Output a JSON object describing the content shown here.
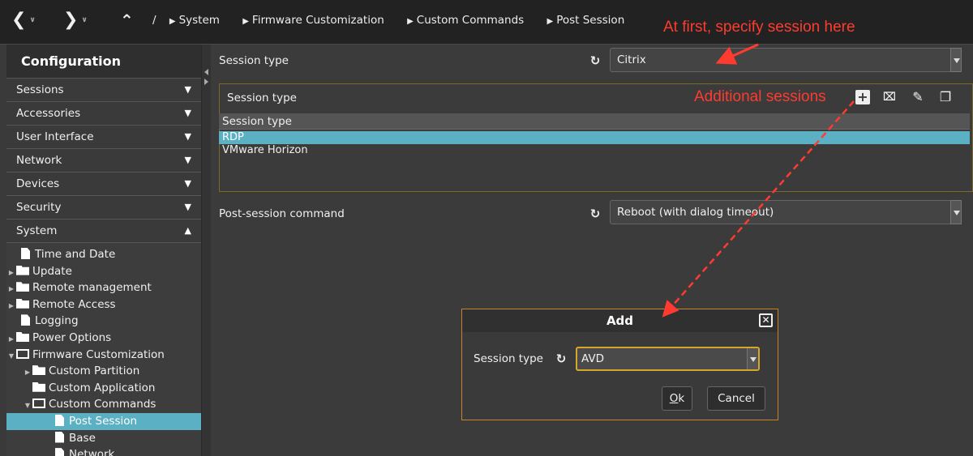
{
  "nav": {
    "back_icon": "chevron-left-icon",
    "forward_icon": "chevron-right-icon",
    "up_icon": "chevron-up-icon"
  },
  "breadcrumb": {
    "root": "/",
    "items": [
      "System",
      "Firmware Customization",
      "Custom Commands",
      "Post Session"
    ]
  },
  "annotations": {
    "top": "At first, specify session here",
    "sessions": "Additional sessions",
    "color": "#ff3b2f"
  },
  "sidebar": {
    "title": "Configuration",
    "sections": [
      {
        "label": "Sessions",
        "state": "collapsed"
      },
      {
        "label": "Accessories",
        "state": "collapsed"
      },
      {
        "label": "User Interface",
        "state": "collapsed"
      },
      {
        "label": "Network",
        "state": "collapsed"
      },
      {
        "label": "Devices",
        "state": "collapsed"
      },
      {
        "label": "Security",
        "state": "collapsed"
      },
      {
        "label": "System",
        "state": "expanded"
      }
    ],
    "tree": [
      {
        "label": "Time and Date"
      },
      {
        "label": "Update"
      },
      {
        "label": "Remote management"
      },
      {
        "label": "Remote Access"
      },
      {
        "label": "Logging"
      },
      {
        "label": "Power Options"
      },
      {
        "label": "Firmware Customization"
      },
      {
        "label": "Custom Partition"
      },
      {
        "label": "Custom Application"
      },
      {
        "label": "Custom Commands"
      },
      {
        "label": "Post Session"
      },
      {
        "label": "Base"
      },
      {
        "label": "Network"
      }
    ]
  },
  "main": {
    "session_type_label": "Session type",
    "session_type_value": "Citrix",
    "group_title": "Session type",
    "table_header": "Session type",
    "rows": [
      "RDP",
      "VMware Horizon"
    ],
    "toolbar_icons": [
      "add-icon",
      "delete-icon",
      "edit-icon",
      "copy-icon"
    ],
    "post_session_label": "Post-session command",
    "post_session_value": "Reboot (with dialog timeout)"
  },
  "dialog": {
    "title": "Add",
    "field_label": "Session type",
    "field_value": "AVD",
    "ok_label": "Ok",
    "ok_mnemonic": "O",
    "ok_rest": "k",
    "cancel_label": "Cancel"
  },
  "colors": {
    "selection": "#5bb0c4",
    "focus": "#d8a528",
    "dialog_border": "#c9822a"
  }
}
